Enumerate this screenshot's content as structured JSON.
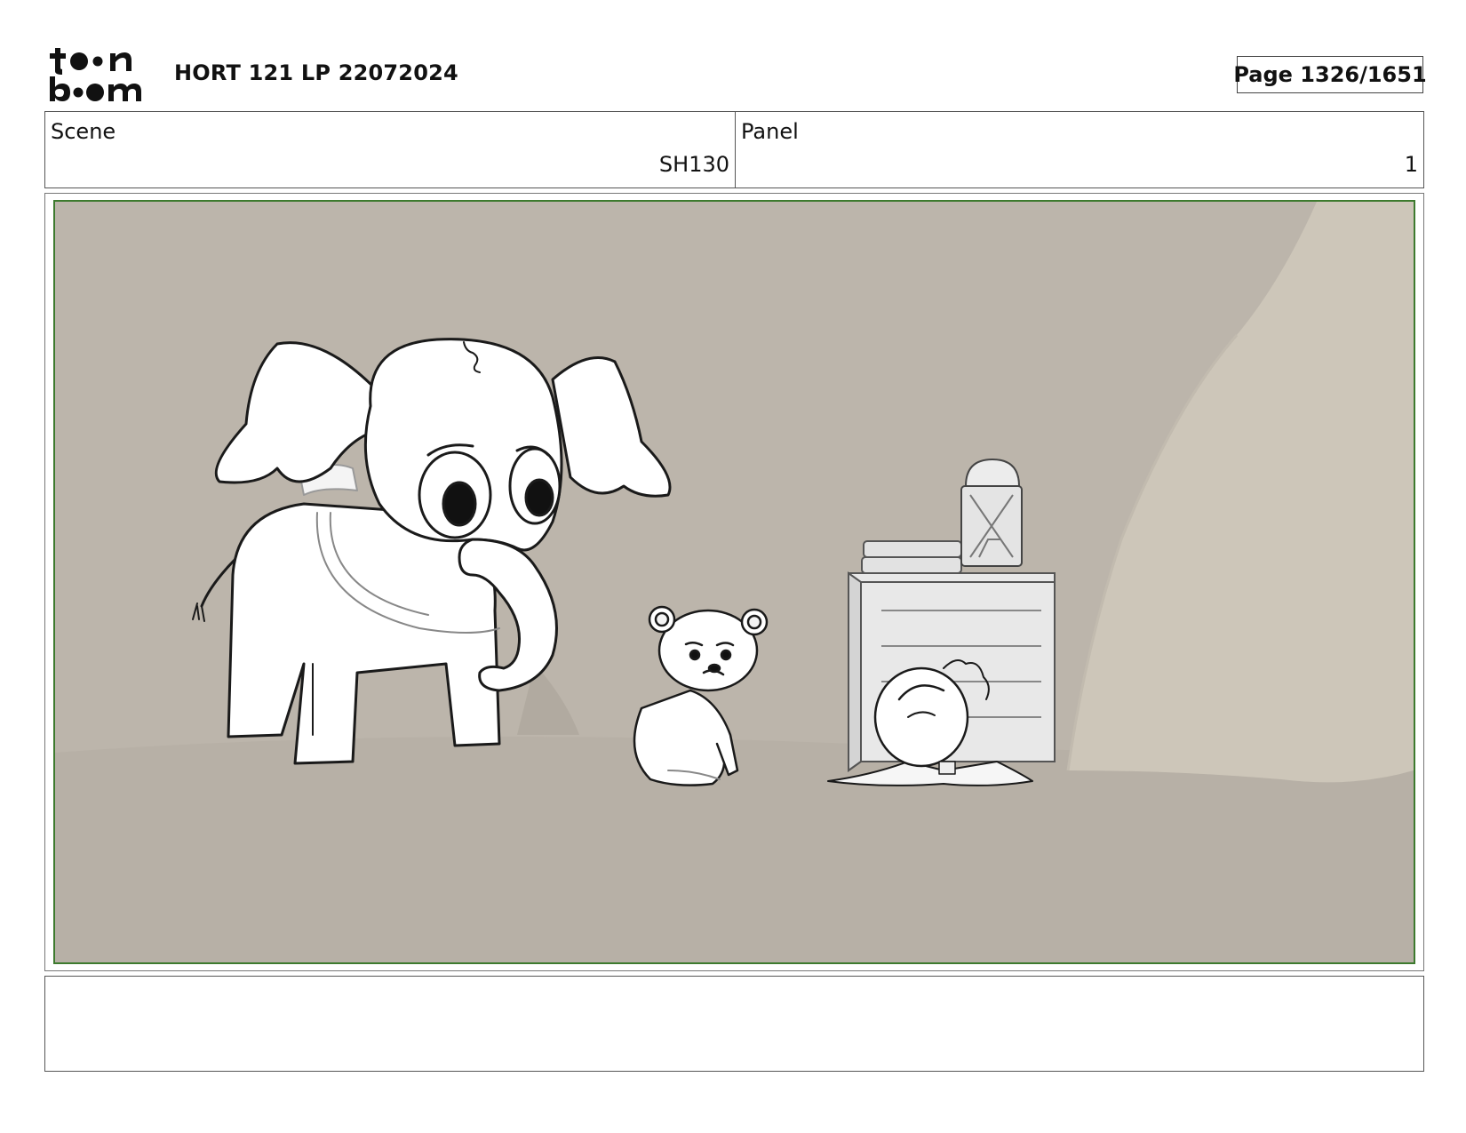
{
  "header": {
    "logo_top": "to●n",
    "logo_bottom": "b●●m",
    "title": "HORT 121 LP 22072024",
    "page_label": "Page 1326/1651"
  },
  "info": {
    "scene_label": "Scene",
    "scene_value": "SH130",
    "panel_label": "Panel",
    "panel_value": "1"
  },
  "frame": {
    "border_color": "#3d7a2e",
    "background_color": "#bcb5ab",
    "characters": [
      "elephant",
      "bear-cub",
      "small-creature"
    ],
    "props": [
      "stacked-books",
      "lantern",
      "wooden-crate",
      "cave-wall"
    ]
  },
  "notes": {
    "text": ""
  }
}
